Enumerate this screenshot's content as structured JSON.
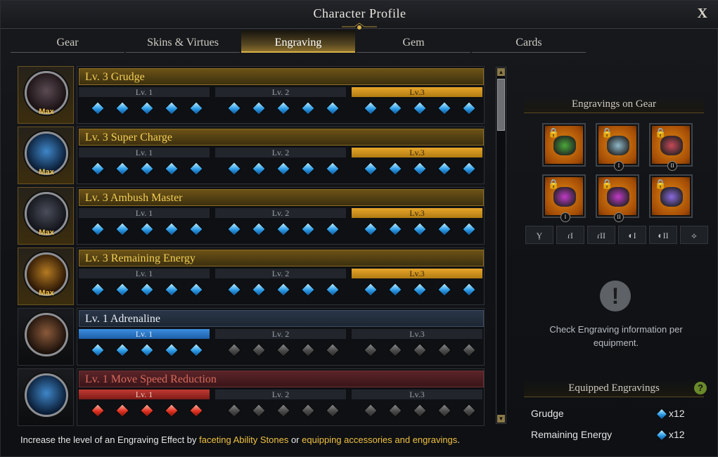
{
  "window": {
    "title": "Character Profile",
    "close_label": "X"
  },
  "tabs": [
    {
      "label": "Gear",
      "active": false
    },
    {
      "label": "Skins & Virtues",
      "active": false
    },
    {
      "label": "Engraving",
      "active": true
    },
    {
      "label": "Gem",
      "active": false
    },
    {
      "label": "Cards",
      "active": false
    }
  ],
  "engravings": [
    {
      "name": "Lv. 3 Grudge",
      "max": true,
      "max_label": "Max",
      "style": "gold",
      "active_level": 3,
      "levels": [
        "Lv. 1",
        "Lv. 2",
        "Lv.3"
      ],
      "filled_nodes": 15,
      "icon": "grudge-icon"
    },
    {
      "name": "Lv. 3 Super Charge",
      "max": true,
      "max_label": "Max",
      "style": "gold",
      "active_level": 3,
      "levels": [
        "Lv. 1",
        "Lv. 2",
        "Lv.3"
      ],
      "filled_nodes": 15,
      "icon": "super-charge-icon"
    },
    {
      "name": "Lv. 3 Ambush Master",
      "max": true,
      "max_label": "Max",
      "style": "gold",
      "active_level": 3,
      "levels": [
        "Lv. 1",
        "Lv. 2",
        "Lv.3"
      ],
      "filled_nodes": 15,
      "icon": "ambush-master-icon"
    },
    {
      "name": "Lv. 3 Remaining Energy",
      "max": true,
      "max_label": "Max",
      "style": "gold",
      "active_level": 3,
      "levels": [
        "Lv. 1",
        "Lv. 2",
        "Lv.3"
      ],
      "filled_nodes": 15,
      "icon": "remaining-energy-icon"
    },
    {
      "name": "Lv. 1 Adrenaline",
      "max": false,
      "max_label": "",
      "style": "blue",
      "active_level": 1,
      "levels": [
        "Lv. 1",
        "Lv. 2",
        "Lv.3"
      ],
      "filled_nodes": 5,
      "icon": "adrenaline-icon"
    },
    {
      "name": "Lv. 1 Move Speed Reduction",
      "max": false,
      "max_label": "",
      "style": "red",
      "active_level": 1,
      "levels": [
        "Lv. 1",
        "Lv. 2",
        "Lv.3"
      ],
      "filled_nodes": 5,
      "icon": "move-speed-reduction-icon"
    }
  ],
  "footer": {
    "prefix": "Increase the level of an Engraving Effect by ",
    "link1": "faceting Ability Stones",
    "middle": " or ",
    "link2": "equipping accessories and engravings",
    "suffix": "."
  },
  "gear_section": {
    "title": "Engravings on Gear",
    "slots": [
      {
        "name": "necklace-slot",
        "roman": "",
        "color": "#4aa83a"
      },
      {
        "name": "earring-1-slot",
        "roman": "I",
        "color": "#8fb8c8"
      },
      {
        "name": "earring-2-slot",
        "roman": "II",
        "color": "#c84a5a"
      },
      {
        "name": "ring-1-slot",
        "roman": "I",
        "color": "#c03ac8"
      },
      {
        "name": "ring-2-slot",
        "roman": "II",
        "color": "#c03ac8"
      },
      {
        "name": "ability-stone-slot",
        "roman": "",
        "color": "#8a6ae0"
      }
    ],
    "categories": [
      "necklace-icon",
      "earring-1-icon",
      "earring-2-icon",
      "ring-1-icon",
      "ring-2-icon",
      "ability-stone-icon"
    ],
    "category_labels": [
      "Ỵ",
      "ɾI",
      "ɾII",
      "◐I",
      "◐II",
      "⟡"
    ],
    "info_text": "Check Engraving information per equipment.",
    "info_icon": "!"
  },
  "equipped_section": {
    "title": "Equipped Engravings",
    "help_label": "?",
    "items": [
      {
        "name": "Grudge",
        "count": "x12"
      },
      {
        "name": "Remaining Energy",
        "count": "x12"
      }
    ]
  }
}
